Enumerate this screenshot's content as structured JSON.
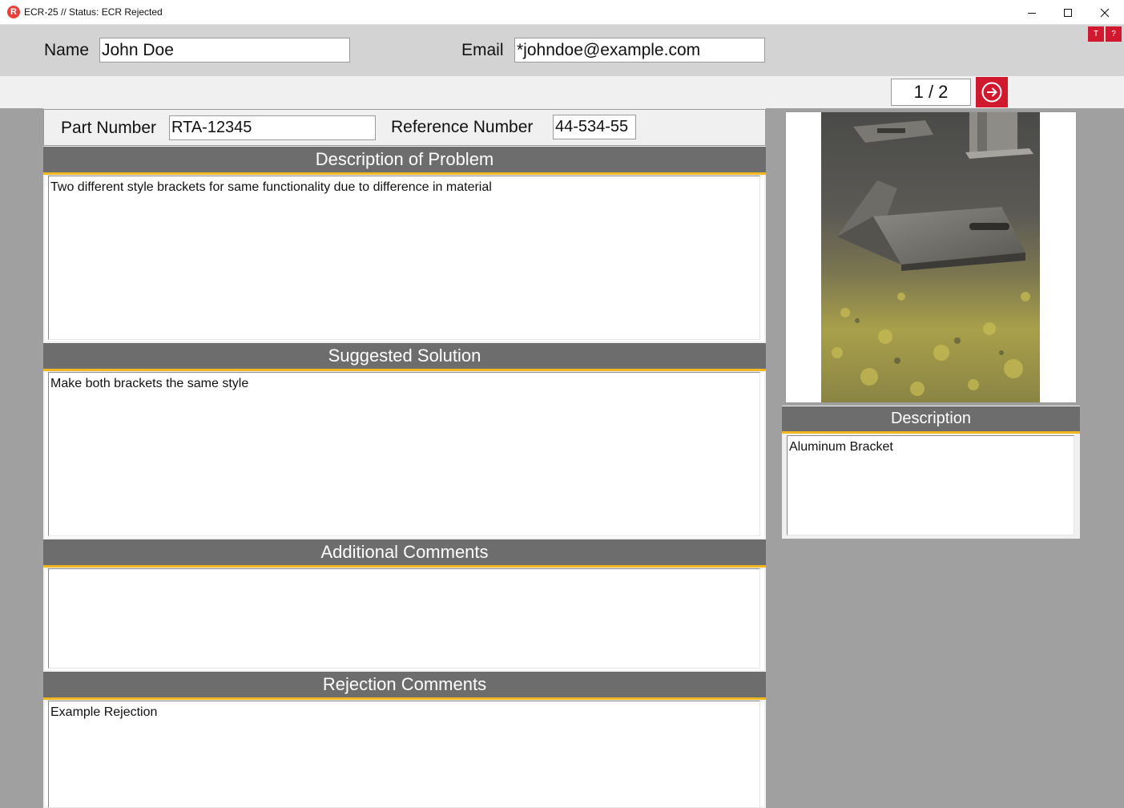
{
  "window": {
    "title": "ECR-25  //  Status: ECR Rejected",
    "icon_letter": "R",
    "controls": [
      "minimize-icon",
      "maximize-icon",
      "close-icon"
    ]
  },
  "header": {
    "name_label": "Name",
    "name_value": "John Doe",
    "email_label": "Email",
    "email_value": "*johndoe@example.com",
    "mini_buttons": [
      "T",
      "?"
    ]
  },
  "navigation": {
    "page_indicator": "1 / 2",
    "next_icon": "arrow-right-circle-icon"
  },
  "part": {
    "part_number_label": "Part Number",
    "part_number_value": "RTA-12345",
    "reference_number_label": "Reference Number",
    "reference_number_value": "44-534-55"
  },
  "sections": {
    "description_title": "Description of Problem",
    "description_text": "Two different style brackets for same functionality due to difference in material",
    "solution_title": "Suggested Solution",
    "solution_text": "Make both brackets the same style",
    "comments_title": "Additional Comments",
    "comments_text": "",
    "rejection_title": "Rejection Comments",
    "rejection_text": "Example Rejection"
  },
  "attachment": {
    "description_title": "Description",
    "description_text": "Aluminum Bracket"
  },
  "colors": {
    "accent_red": "#d0182e",
    "section_header_bg": "#6d6d6d",
    "section_header_underline": "#f2b71e",
    "background_gray": "#a0a0a0"
  }
}
